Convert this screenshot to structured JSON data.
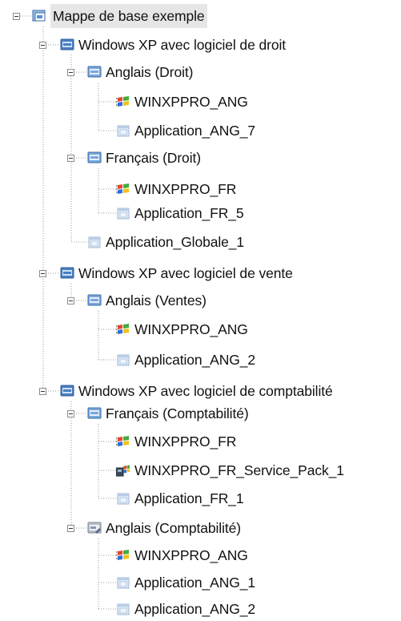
{
  "tree": {
    "nodes": [
      {
        "label": "Mappe de base exemple",
        "type": "root",
        "expanded": true,
        "selected": true
      },
      {
        "label": "Windows XP avec logiciel de droit",
        "type": "group",
        "expanded": true
      },
      {
        "label": "Anglais (Droit)",
        "type": "subgroup",
        "expanded": true
      },
      {
        "label": "WINXPPRO_ANG",
        "type": "os-image"
      },
      {
        "label": "Application_ANG_7",
        "type": "app"
      },
      {
        "label": "Français (Droit)",
        "type": "subgroup",
        "expanded": true
      },
      {
        "label": "WINXPPRO_FR",
        "type": "os-image"
      },
      {
        "label": "Application_FR_5",
        "type": "app"
      },
      {
        "label": "Application_Globale_1",
        "type": "app"
      },
      {
        "label": "Windows XP avec logiciel de vente",
        "type": "group",
        "expanded": true
      },
      {
        "label": "Anglais (Ventes)",
        "type": "subgroup",
        "expanded": true
      },
      {
        "label": "WINXPPRO_ANG",
        "type": "os-image"
      },
      {
        "label": "Application_ANG_2",
        "type": "app"
      },
      {
        "label": "Windows XP avec logiciel de comptabilité",
        "type": "group",
        "expanded": true
      },
      {
        "label": "Français (Comptabilité)",
        "type": "subgroup",
        "expanded": true
      },
      {
        "label": "WINXPPRO_FR",
        "type": "os-image"
      },
      {
        "label": "WINXPPRO_FR_Service_Pack_1",
        "type": "service-pack"
      },
      {
        "label": "Application_FR_1",
        "type": "app"
      },
      {
        "label": "Anglais (Comptabilité)",
        "type": "subgroup-alt",
        "expanded": true
      },
      {
        "label": "WINXPPRO_ANG",
        "type": "os-image"
      },
      {
        "label": "Application_ANG_1",
        "type": "app"
      },
      {
        "label": "Application_ANG_2",
        "type": "app"
      }
    ]
  }
}
